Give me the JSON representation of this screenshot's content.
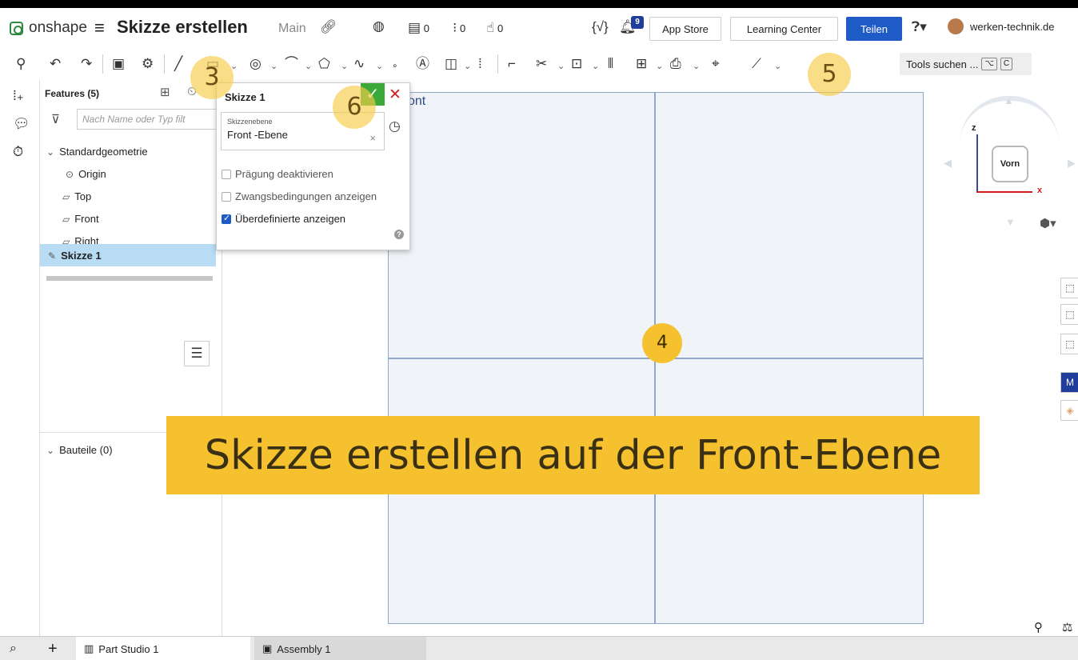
{
  "topbar": {
    "app_name": "onshape",
    "document_title": "Skizze erstellen",
    "workspace": "Main",
    "counters": [
      {
        "icon": "versions-icon",
        "value": "0"
      },
      {
        "icon": "branch-icon",
        "value": "0"
      },
      {
        "icon": "like-icon",
        "value": "0"
      }
    ],
    "notification_count": "9",
    "app_store_label": "App Store",
    "learning_center_label": "Learning Center",
    "share_label": "Teilen",
    "user_name": "werken-technik.de"
  },
  "toolbar": {
    "search_label": "Tools suchen ...",
    "shortcut_keys": [
      "⌥",
      "C"
    ]
  },
  "features": {
    "header": "Features (5)",
    "filter_placeholder": "Nach Name oder Typ filt",
    "group_label": "Standardgeometrie",
    "items": [
      {
        "label": "Origin",
        "icon": "origin-icon"
      },
      {
        "label": "Top",
        "icon": "plane-icon"
      },
      {
        "label": "Front",
        "icon": "plane-icon"
      },
      {
        "label": "Right",
        "icon": "plane-icon"
      }
    ],
    "selected_item": "Skizze 1",
    "parts_label": "Bauteile (0)"
  },
  "sketch_dialog": {
    "title": "Skizze 1",
    "field_label": "Skizzenebene",
    "field_value": "Front -Ebene",
    "options": [
      {
        "label": "Prägung deaktivieren",
        "checked": false
      },
      {
        "label": "Zwangsbedingungen anzeigen",
        "checked": false
      },
      {
        "label": "Überdefinierte anzeigen",
        "checked": true
      }
    ]
  },
  "canvas": {
    "plane_label": "ont"
  },
  "viewcube": {
    "face_label": "Vorn",
    "axis_z": "z",
    "axis_x": "x"
  },
  "tabs": [
    {
      "label": "Part Studio 1",
      "active": true
    },
    {
      "label": "Assembly 1",
      "active": false
    }
  ],
  "annotations": {
    "markers": [
      "3",
      "4",
      "5",
      "6"
    ],
    "caption": "Skizze erstellen auf der Front-Ebene"
  },
  "colors": {
    "accent": "#1f5bc6",
    "confirm": "#3aa93a",
    "cancel": "#d02020",
    "highlight": "#f6c12e",
    "selection": "#b8dcf3"
  }
}
